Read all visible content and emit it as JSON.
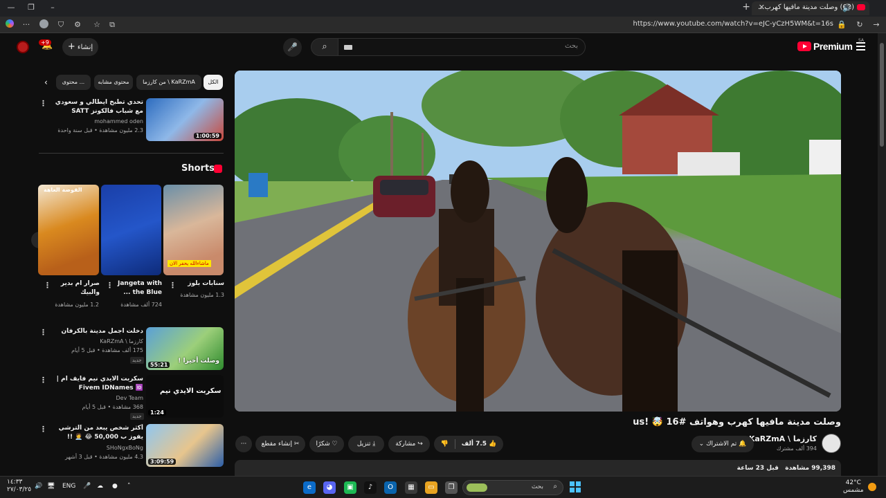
{
  "browser": {
    "tab_title": "(62) وصلت مدينة مافيها كهرب...",
    "url": "https://www.youtube.com/watch?v=eJC-yCzH5WM&t=16s",
    "tab_close": "✕",
    "new_tab": "+"
  },
  "masthead": {
    "create_label": "إنشاء",
    "notification_badge": "+9",
    "search_placeholder": "بحث",
    "logo_text": "Premium",
    "logo_country": "SA"
  },
  "video": {
    "title": "وصلت مدينة مافيها كهرب وهواتف #16 🤯 !us",
    "channel_name": "كارزما \\ KaRZmA",
    "subscribers": "394 ألف مشترك",
    "subscribed_label": "تم الاشتراك",
    "like_count": "7.5 ألف",
    "share_label": "مشاركة",
    "download_label": "تنزيل",
    "thanks_label": "شكرًا",
    "clip_label": "إنشاء مقطع",
    "more_label": "···",
    "views": "99,398 مشاهدة",
    "age": "قبل 23 ساعة"
  },
  "sidebar": {
    "chips": [
      "الكل",
      "من كارزما \\ KaRZmA",
      "محتوى مشابه",
      "محتوى ..."
    ],
    "top_video": {
      "title": "تحدي تطبخ ايطالي و سعودي مع شباب فالكونز SATT",
      "channel": "mohammed oden",
      "meta": "2.3 مليون مشاهدة • قبل سنة واحدة",
      "duration": "1:00:59"
    },
    "shorts_title": "Shorts",
    "shorts": [
      {
        "title": "سنابات بلوز",
        "views": "1.3 مليون مشاهدة",
        "thumb_text": "ماشاءالله يحفر الان"
      },
      {
        "title": "Jangeta with the Blue ...",
        "views": "724 ألف مشاهدة",
        "thumb_text": ""
      },
      {
        "title": "صرار ام بدير والبيك",
        "views": "1.2 مليون مشاهدة",
        "thumb_text": "القوضة العاهة"
      }
    ],
    "videos": [
      {
        "title": "دخلت اجمل مدينة بالكرفان #12 🤯 us",
        "channel": "كارزما \\ KaRZmA",
        "meta": "175 ألف مشاهدة • قبل 5 أيام",
        "badge": "جديد",
        "duration": "55:21",
        "thumb_text": "وصلت أخيرا !"
      },
      {
        "title": "سكربت الايدي نيم فايف ام | Fivem IDNames 🆔",
        "channel": "Dev Team",
        "meta": "368 مشاهدة • قبل 5 أيام",
        "badge": "جديد",
        "duration": "1:24",
        "thumb_text": "سكربت الايدي نيم"
      },
      {
        "title": "أكثر شخص يبعد من الترشي يفوز ب 50,000 😂 🧑‍💼 !!",
        "channel": "SHoNgxBoNg",
        "meta": "4.3 مليون مشاهدة • قبل 3 أشهر",
        "badge": "",
        "duration": "3:09:59",
        "thumb_text": ""
      }
    ]
  },
  "taskbar": {
    "time": "١٤:٣٣",
    "date": "٢٧/٠٣/٢٥",
    "lang": "ENG",
    "weather_temp": "42°C",
    "weather_desc": "مشمس",
    "search_placeholder": "بحث"
  }
}
